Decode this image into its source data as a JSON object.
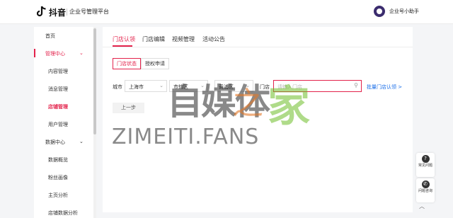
{
  "header": {
    "brand": "抖音",
    "platform": "企业号管理平台",
    "assistant": "企业号小助手"
  },
  "sidebar": {
    "items": [
      {
        "label": "首页"
      },
      {
        "label": "管理中心",
        "chevron": "⌄"
      },
      {
        "label": "内容管理"
      },
      {
        "label": "消息管理"
      },
      {
        "label": "店铺管理"
      },
      {
        "label": "用户管理"
      },
      {
        "label": "数据中心",
        "chevron": "⌄"
      },
      {
        "label": "数据概览"
      },
      {
        "label": "粉丝画像"
      },
      {
        "label": "主页分析"
      },
      {
        "label": "店铺数据分析"
      }
    ]
  },
  "tabs": [
    "门店认领",
    "门店编辑",
    "视频管理",
    "活动公告"
  ],
  "segments": [
    "门店状态",
    "授权申请"
  ],
  "filters": {
    "city_label": "城市",
    "city": "上海市",
    "district": "市辖区",
    "area": "黄浦区",
    "store_label": "门店",
    "store_placeholder": "请输入门店",
    "batch_link": "批量门店认领 >"
  },
  "prev_button": "上一步",
  "float": {
    "faq": {
      "glyph": "?",
      "text": "常见问题"
    },
    "consult": {
      "glyph": "✆",
      "text": "问题咨询"
    },
    "top": "︿"
  },
  "watermark": {
    "cn": "自媒体",
    "zhi": "之",
    "jia": "家",
    "en": "ZIMEITI.FANS"
  },
  "colors": {
    "accent": "#e3224b",
    "link": "#1a6ee8"
  }
}
